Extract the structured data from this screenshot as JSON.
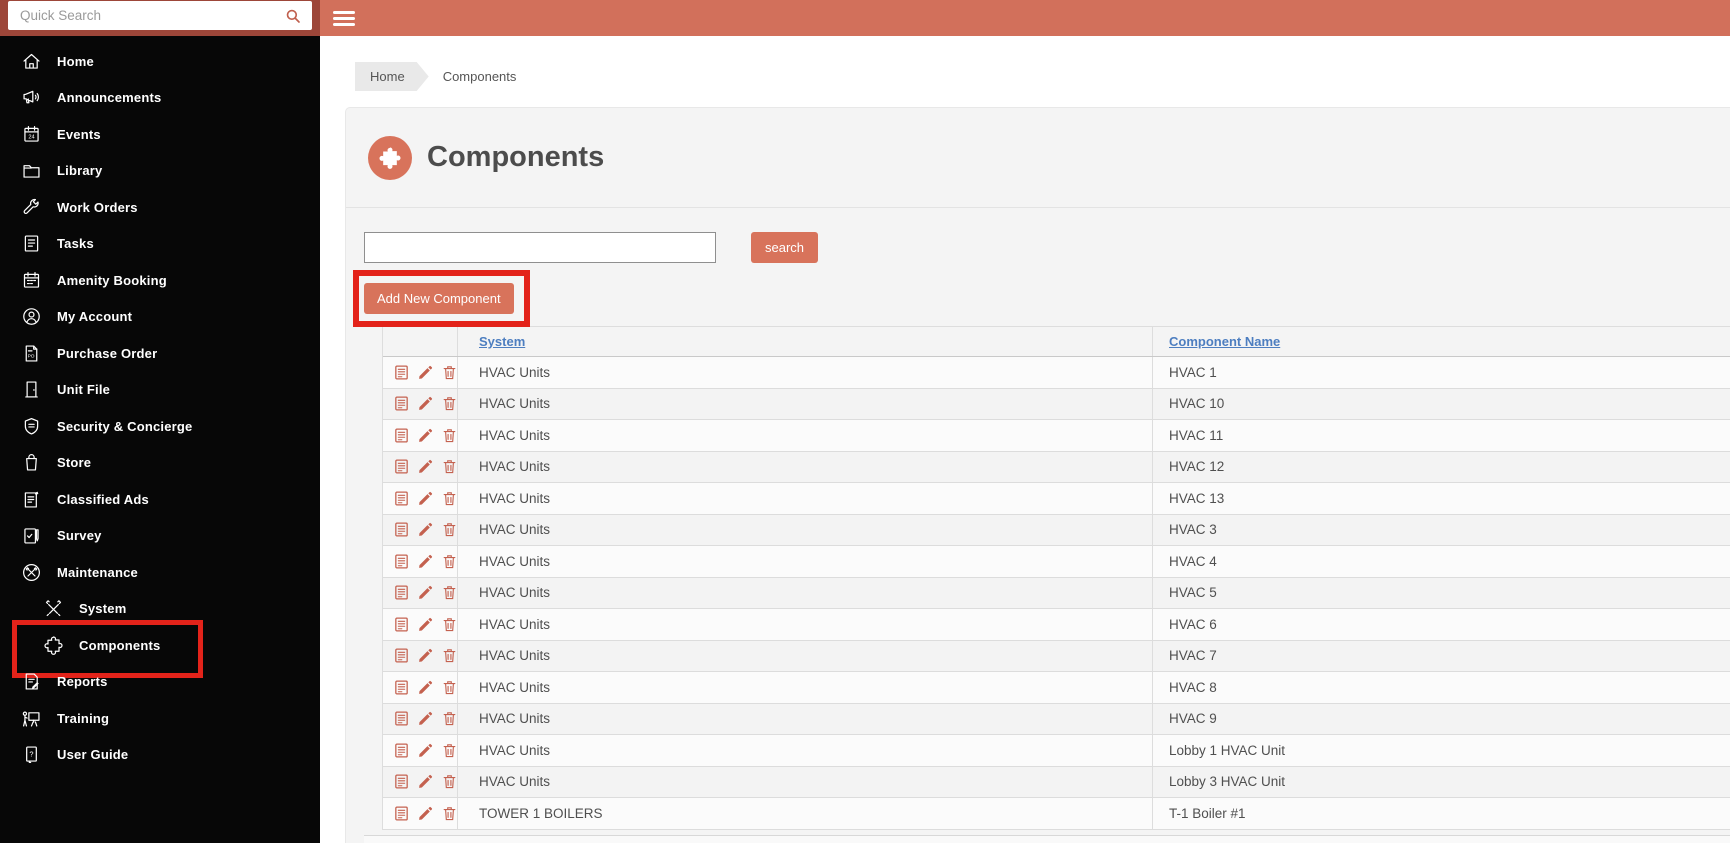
{
  "topbar": {
    "quick_search_placeholder": "Quick Search",
    "search_value": ""
  },
  "sidebar": {
    "items": [
      {
        "label": "Home",
        "icon": "home"
      },
      {
        "label": "Announcements",
        "icon": "announcements"
      },
      {
        "label": "Events",
        "icon": "events"
      },
      {
        "label": "Library",
        "icon": "library"
      },
      {
        "label": "Work Orders",
        "icon": "work-orders"
      },
      {
        "label": "Tasks",
        "icon": "tasks"
      },
      {
        "label": "Amenity Booking",
        "icon": "amenity-booking"
      },
      {
        "label": "My Account",
        "icon": "my-account"
      },
      {
        "label": "Purchase Order",
        "icon": "purchase-order"
      },
      {
        "label": "Unit File",
        "icon": "unit-file"
      },
      {
        "label": "Security & Concierge",
        "icon": "security"
      },
      {
        "label": "Store",
        "icon": "store"
      },
      {
        "label": "Classified Ads",
        "icon": "classified-ads"
      },
      {
        "label": "Survey",
        "icon": "survey"
      },
      {
        "label": "Maintenance",
        "icon": "maintenance"
      },
      {
        "label": "System",
        "icon": "system",
        "sub": true
      },
      {
        "label": "Components",
        "icon": "components",
        "sub": true,
        "highlighted": true
      },
      {
        "label": "Reports",
        "icon": "reports"
      },
      {
        "label": "Training",
        "icon": "training"
      },
      {
        "label": "User Guide",
        "icon": "user-guide"
      }
    ]
  },
  "breadcrumb": {
    "home": "Home",
    "current": "Components"
  },
  "page": {
    "title": "Components",
    "icon": "puzzle"
  },
  "toolbar": {
    "search_value": "",
    "search_button_label": "search",
    "add_button_label": "Add New Component"
  },
  "table": {
    "columns": [
      "System",
      "Component Name"
    ],
    "row_action_icons": [
      "details",
      "edit",
      "delete"
    ],
    "rows": [
      {
        "system": "HVAC Units",
        "component_name": "HVAC 1"
      },
      {
        "system": "HVAC Units",
        "component_name": "HVAC 10"
      },
      {
        "system": "HVAC Units",
        "component_name": "HVAC 11"
      },
      {
        "system": "HVAC Units",
        "component_name": "HVAC 12"
      },
      {
        "system": "HVAC Units",
        "component_name": "HVAC 13"
      },
      {
        "system": "HVAC Units",
        "component_name": "HVAC 3"
      },
      {
        "system": "HVAC Units",
        "component_name": "HVAC 4"
      },
      {
        "system": "HVAC Units",
        "component_name": "HVAC 5"
      },
      {
        "system": "HVAC Units",
        "component_name": "HVAC 6"
      },
      {
        "system": "HVAC Units",
        "component_name": "HVAC 7"
      },
      {
        "system": "HVAC Units",
        "component_name": "HVAC 8"
      },
      {
        "system": "HVAC Units",
        "component_name": "HVAC 9"
      },
      {
        "system": "HVAC Units",
        "component_name": "Lobby 1 HVAC Unit"
      },
      {
        "system": "HVAC Units",
        "component_name": "Lobby 3 HVAC Unit"
      },
      {
        "system": "TOWER 1 BOILERS",
        "component_name": "T-1 Boiler #1"
      }
    ]
  },
  "colors": {
    "accent": "#d8735b",
    "topbar": "#d2705b",
    "annotation_red": "#e3231a",
    "link_blue": "#4d7ec0",
    "sidebar_bg": "#070707"
  }
}
